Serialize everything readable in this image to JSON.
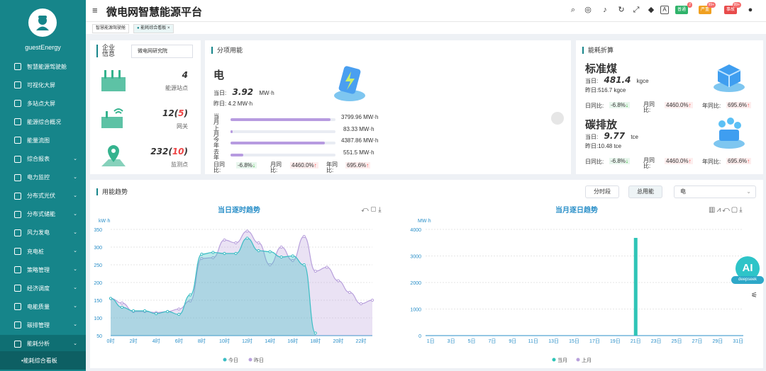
{
  "sidebar": {
    "username": "guestEnergy",
    "items": [
      {
        "label": "智慧能源驾驶舱",
        "icon": "cockpit-icon",
        "expand": false
      },
      {
        "label": "可视化大屏",
        "icon": "screen-icon",
        "expand": false
      },
      {
        "label": "多站点大屏",
        "icon": "multi-screen-icon",
        "expand": false
      },
      {
        "label": "能源综合概况",
        "icon": "overview-icon",
        "expand": false
      },
      {
        "label": "能量流图",
        "icon": "flow-icon",
        "expand": false
      },
      {
        "label": "综合报表",
        "icon": "report-icon",
        "expand": true
      },
      {
        "label": "电力监控",
        "icon": "monitor-icon",
        "expand": true
      },
      {
        "label": "分布式光伏",
        "icon": "solar-icon",
        "expand": true
      },
      {
        "label": "分布式储能",
        "icon": "storage-icon",
        "expand": true
      },
      {
        "label": "风力发电",
        "icon": "wind-icon",
        "expand": true
      },
      {
        "label": "充电桩",
        "icon": "charger-icon",
        "expand": true
      },
      {
        "label": "策略管理",
        "icon": "strategy-icon",
        "expand": true
      },
      {
        "label": "经济调度",
        "icon": "dispatch-icon",
        "expand": true
      },
      {
        "label": "电能质量",
        "icon": "quality-icon",
        "expand": true
      },
      {
        "label": "碳排管理",
        "icon": "carbon-icon",
        "expand": true
      },
      {
        "label": "能耗分析",
        "icon": "analysis-icon",
        "expand": true
      }
    ],
    "subitem": "能耗综合看板"
  },
  "header": {
    "title": "微电网智慧能源平台",
    "badges": [
      {
        "label": "普通",
        "count": "2",
        "color": "#2fb36a"
      },
      {
        "label": "严重",
        "count": "99+",
        "color": "#f0a020"
      },
      {
        "label": "事故",
        "count": "99+",
        "color": "#e84b4b"
      }
    ]
  },
  "tabs": [
    "智慧能源驾驶舱",
    "能耗综合看板"
  ],
  "enterprise": {
    "title": "企业信息",
    "company": "微电网研究院",
    "stats": [
      {
        "value": "4",
        "extra": "",
        "label": "能源站点"
      },
      {
        "value": "12",
        "extra": "5",
        "label": "网关"
      },
      {
        "value": "232",
        "extra": "10",
        "label": "监测点"
      }
    ]
  },
  "usage": {
    "title": "分项用能",
    "type": "电",
    "today_label": "当日:",
    "today_value": "3.92",
    "today_unit": "MW·h",
    "yesterday": "昨日: 4.2 MW·h",
    "bars": [
      {
        "label": "当月",
        "value": "3799.96 MW·h",
        "fill": 0.95
      },
      {
        "label": "上月",
        "value": "83.33 MW·h",
        "fill": 0.02
      },
      {
        "label": "今年",
        "value": "4387.86 MW·h",
        "fill": 0.9
      },
      {
        "label": "去年",
        "value": "551.5 MW·h",
        "fill": 0.12
      }
    ],
    "dod_label": "日同比:",
    "dod": "-6.8%",
    "mom_label": "月同比:",
    "mom": "4460.0%",
    "yoy_label": "年同比:",
    "yoy": "695.6%"
  },
  "conversion": {
    "title": "能耗折算",
    "coal": {
      "name": "标准煤",
      "today_label": "当日:",
      "today": "481.4",
      "unit": "kgce",
      "yesterday": "昨日:516.7 kgce",
      "dod_label": "日同比:",
      "dod": "-6.8%",
      "mom_label": "月同比:",
      "mom": "4460.0%",
      "yoy_label": "年同比:",
      "yoy": "695.6%"
    },
    "carbon": {
      "name": "碳排放",
      "today_label": "当日:",
      "today": "9.77",
      "unit": "tce",
      "yesterday": "昨日:10.48 tce",
      "dod_label": "日同比:",
      "dod": "-6.8%",
      "mom_label": "月同比:",
      "mom": "4460.0%",
      "yoy_label": "年同比:",
      "yoy": "695.6%"
    }
  },
  "trend": {
    "title": "用能趋势",
    "btn_hourly": "分时段",
    "btn_total": "总用能",
    "select_value": "电"
  },
  "ai": {
    "label": "AI",
    "sub": "deepseek"
  },
  "chart_data": [
    {
      "type": "area",
      "title": "当日逐时趋势",
      "ylabel": "kW·h",
      "ylim": [
        50,
        350
      ],
      "yticks": [
        50,
        100,
        150,
        200,
        250,
        300,
        350
      ],
      "xticks": [
        "0时",
        "2时",
        "4时",
        "6时",
        "8时",
        "10时",
        "12时",
        "14时",
        "16时",
        "18时",
        "20时",
        "22时"
      ],
      "x": [
        0,
        1,
        2,
        3,
        4,
        5,
        6,
        7,
        8,
        9,
        10,
        11,
        12,
        13,
        14,
        15,
        16,
        17,
        18,
        19,
        20,
        21,
        22,
        23
      ],
      "series": [
        {
          "name": "今日",
          "color": "#3bbdc4",
          "values": [
            155,
            130,
            120,
            120,
            112,
            118,
            110,
            165,
            280,
            285,
            282,
            282,
            325,
            290,
            287,
            272,
            275,
            250,
            57
          ]
        },
        {
          "name": "昨日",
          "color": "#b8a0dc",
          "values": [
            155,
            142,
            118,
            118,
            115,
            118,
            125,
            148,
            268,
            270,
            320,
            312,
            345,
            312,
            250,
            300,
            262,
            330,
            232,
            243,
            205,
            172,
            140,
            150
          ]
        }
      ]
    },
    {
      "type": "bar",
      "title": "当月逐日趋势",
      "ylabel": "MW·h",
      "ylim": [
        0,
        4000
      ],
      "yticks": [
        0,
        1000,
        2000,
        3000,
        4000
      ],
      "xticks": [
        "1日",
        "3日",
        "5日",
        "7日",
        "9日",
        "11日",
        "13日",
        "15日",
        "17日",
        "19日",
        "21日",
        "23日",
        "25日",
        "27日",
        "29日",
        "31日"
      ],
      "days": 31,
      "series": [
        {
          "name": "当月",
          "color": "#2ec4b6",
          "values": [
            0,
            0,
            0,
            0,
            0,
            0,
            0,
            0,
            0,
            0,
            0,
            0,
            0,
            0,
            0,
            0,
            0,
            0,
            0,
            0,
            3680,
            0,
            0,
            0,
            0,
            0,
            0,
            0,
            0,
            0,
            0
          ]
        },
        {
          "name": "上月",
          "color": "#b8a0dc",
          "values": [
            0,
            0,
            0,
            0,
            0,
            0,
            0,
            0,
            0,
            0,
            0,
            0,
            0,
            0,
            0,
            0,
            0,
            0,
            0,
            0,
            0,
            0,
            0,
            0,
            0,
            0,
            0,
            0,
            0,
            0,
            0
          ]
        }
      ]
    }
  ]
}
